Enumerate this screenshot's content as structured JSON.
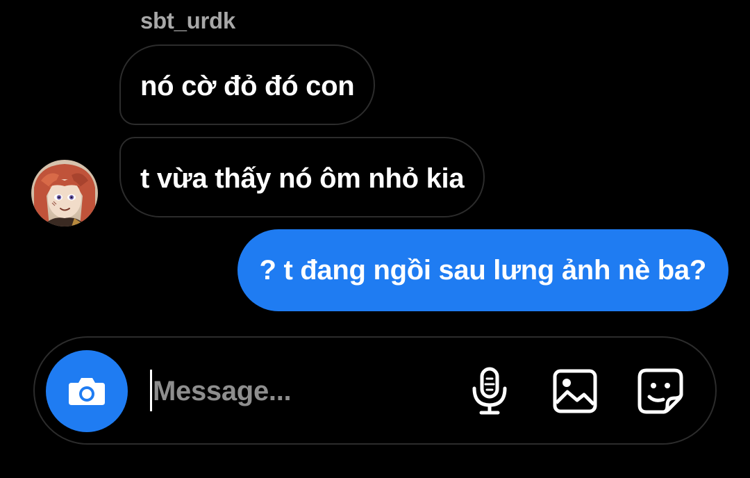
{
  "thread": {
    "sender_username": "sbt_urdk",
    "messages": [
      {
        "direction": "incoming",
        "text": "nó cờ đỏ đó con"
      },
      {
        "direction": "incoming",
        "text": "t vừa thấy nó ôm nhỏ kia"
      },
      {
        "direction": "outgoing",
        "text": "? t đang ngồi sau lưng ảnh nè ba?"
      }
    ]
  },
  "composer": {
    "placeholder": "Message...",
    "value": "",
    "icons": {
      "camera": "camera-icon",
      "mic": "microphone-icon",
      "gallery": "image-icon",
      "sticker": "sticker-icon"
    }
  },
  "colors": {
    "background": "#000000",
    "accent": "#1f7cf2",
    "incoming_border": "#2c2c2c",
    "username": "#a8a8a8",
    "placeholder": "#8e8e8e"
  }
}
